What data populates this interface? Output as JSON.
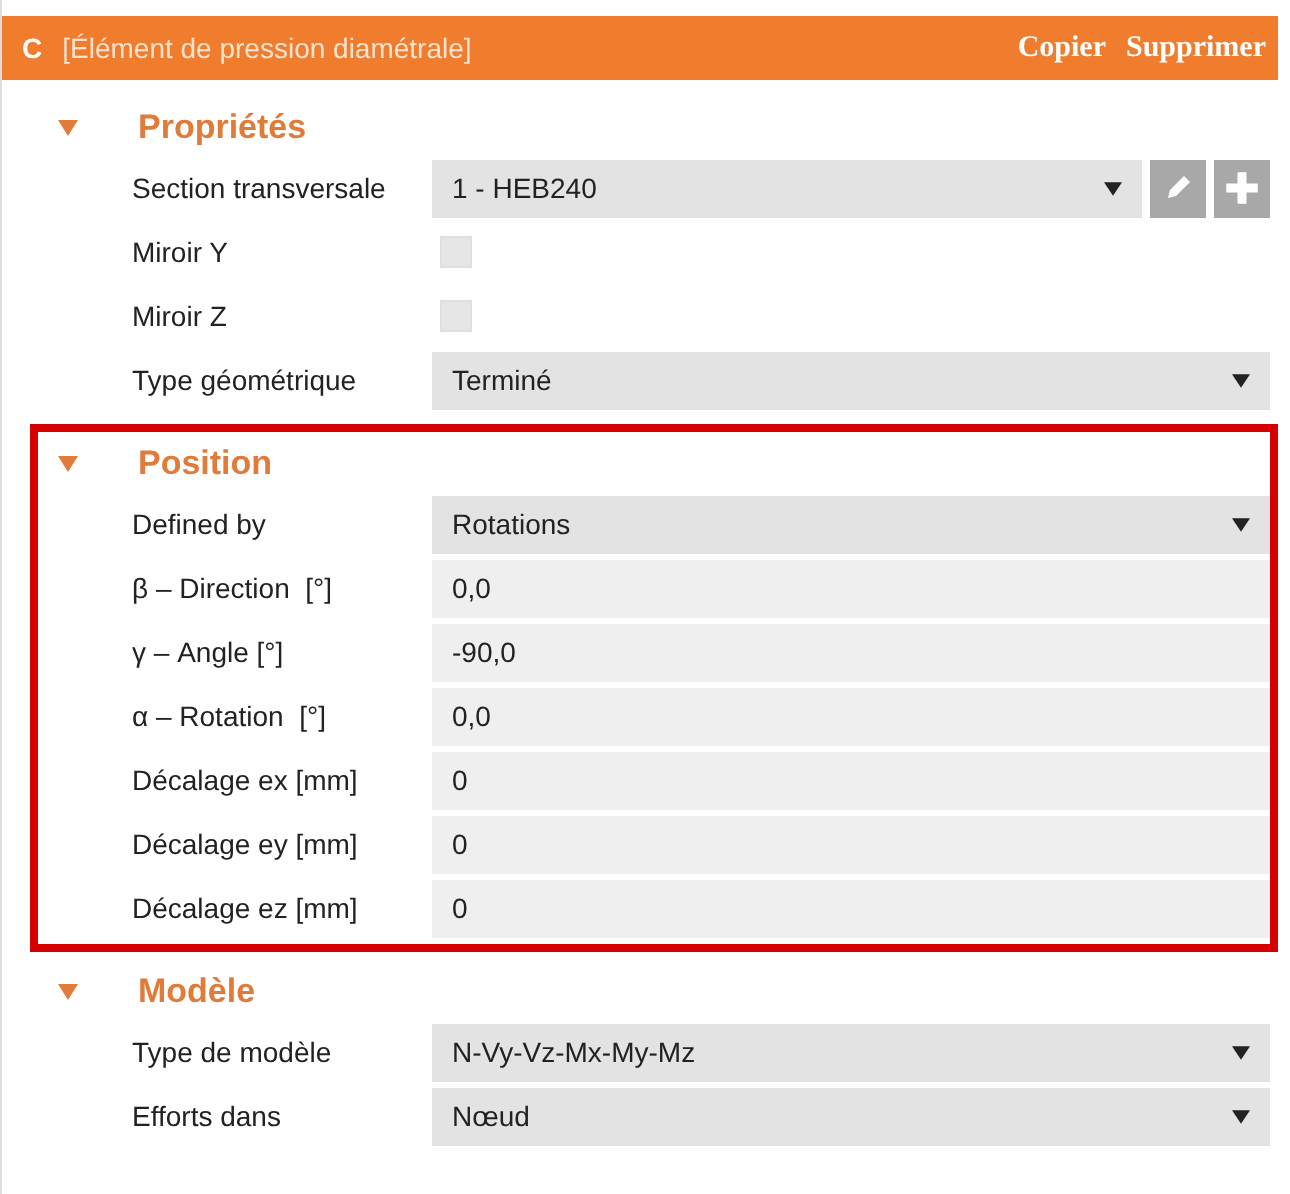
{
  "header": {
    "letter": "C",
    "title": "[Élément de pression diamétrale]",
    "actions": [
      "Copier",
      "Supprimer"
    ]
  },
  "sections": [
    {
      "title": "Propriétés",
      "expanded": true,
      "highlighted": false,
      "rows": [
        {
          "kind": "select",
          "label": "Section transversale",
          "value": "1 - HEB240",
          "tools": true
        },
        {
          "kind": "checkbox",
          "label": "Miroir Y",
          "checked": false
        },
        {
          "kind": "checkbox",
          "label": "Miroir Z",
          "checked": false
        },
        {
          "kind": "select",
          "label": "Type géométrique",
          "value": "Terminé"
        }
      ]
    },
    {
      "title": "Position",
      "expanded": true,
      "highlighted": true,
      "rows": [
        {
          "kind": "select",
          "label": "Defined by",
          "value": "Rotations"
        },
        {
          "kind": "input",
          "label": "β – Direction  [°]",
          "value": "0,0"
        },
        {
          "kind": "input",
          "label": "γ – Angle [°]",
          "value": "-90,0"
        },
        {
          "kind": "input",
          "label": "α – Rotation  [°]",
          "value": "0,0"
        },
        {
          "kind": "input",
          "label": "Décalage ex [mm]",
          "value": "0"
        },
        {
          "kind": "input",
          "label": "Décalage ey [mm]",
          "value": "0"
        },
        {
          "kind": "input",
          "label": "Décalage ez [mm]",
          "value": "0"
        }
      ]
    },
    {
      "title": "Modèle",
      "expanded": true,
      "highlighted": false,
      "rows": [
        {
          "kind": "select",
          "label": "Type de modèle",
          "value": "N-Vy-Vz-Mx-My-Mz"
        },
        {
          "kind": "select",
          "label": "Efforts dans",
          "value": "Nœud"
        }
      ]
    }
  ]
}
